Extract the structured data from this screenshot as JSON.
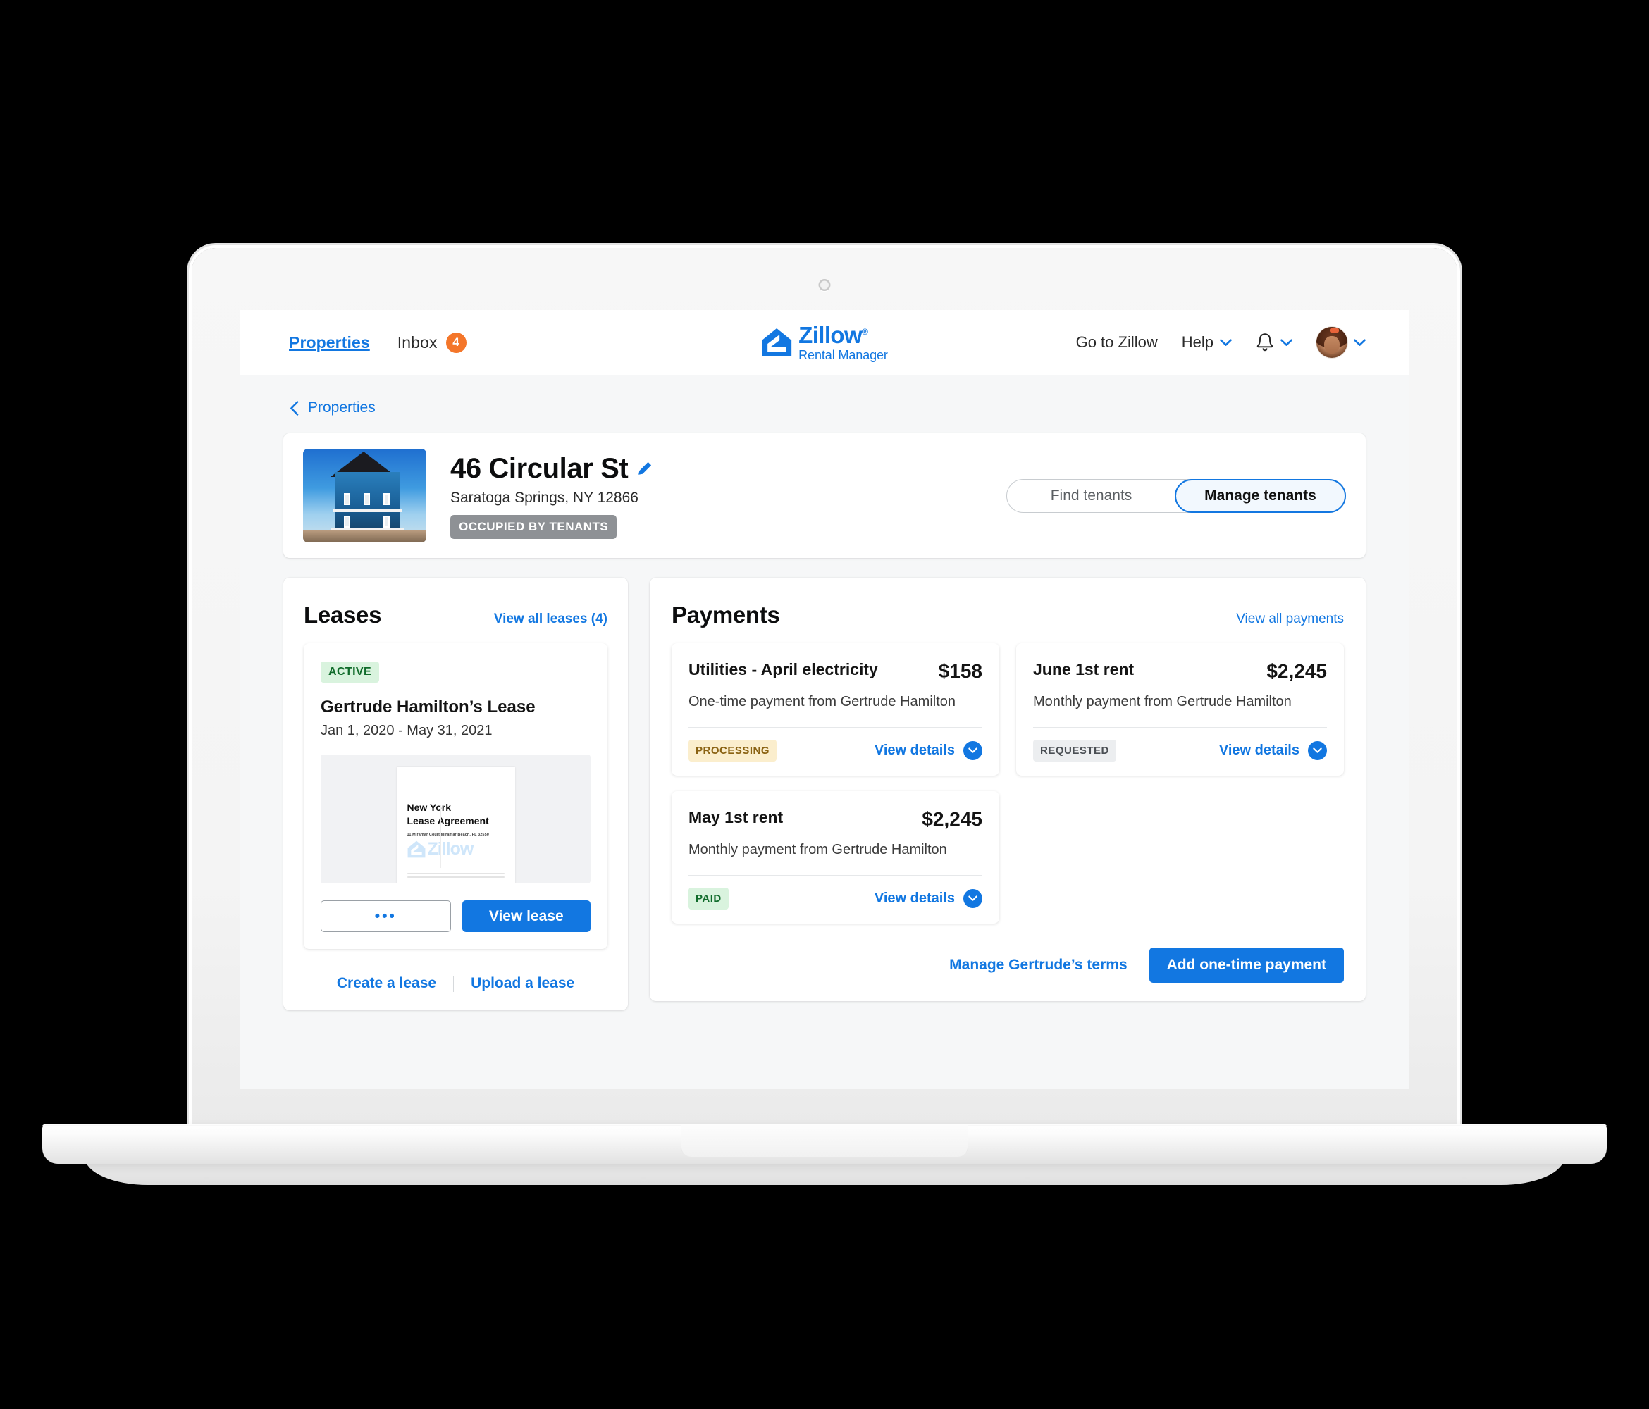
{
  "brand": {
    "name": "Zillow",
    "sub": "Rental Manager",
    "color": "#1277e1"
  },
  "nav": {
    "properties": "Properties",
    "inbox": "Inbox",
    "inbox_count": "4",
    "go_to_zillow": "Go to Zillow",
    "help": "Help"
  },
  "breadcrumb": {
    "label": "Properties"
  },
  "property": {
    "title": "46 Circular St",
    "address": "Saratoga Springs, NY 12866",
    "status": "OCCUPIED BY TENANTS",
    "toggle": {
      "find": "Find tenants",
      "manage": "Manage tenants"
    }
  },
  "leases": {
    "title": "Leases",
    "view_all": "View all leases (4)",
    "card": {
      "status": "ACTIVE",
      "name": "Gertrude Hamilton’s Lease",
      "dates": "Jan 1, 2020 - May 31, 2021",
      "doc": {
        "line1": "New York",
        "line2": "Lease Agreement",
        "address": "11 Miramar Court Miramar Beach, FL 32550",
        "watermark": "Zillow"
      },
      "more_label": "•••",
      "view_label": "View lease"
    },
    "create": "Create a lease",
    "upload": "Upload a lease"
  },
  "payments": {
    "title": "Payments",
    "view_all": "View all payments",
    "details_label": "View details",
    "items": [
      {
        "title": "Utilities - April electricity",
        "amount": "$158",
        "from": "One-time payment from Gertrude Hamilton",
        "status": "PROCESSING",
        "status_kind": "processing"
      },
      {
        "title": "June 1st rent",
        "amount": "$2,245",
        "from": "Monthly payment from Gertrude Hamilton",
        "status": "REQUESTED",
        "status_kind": "requested"
      },
      {
        "title": "May 1st rent",
        "amount": "$2,245",
        "from": "Monthly payment from Gertrude Hamilton",
        "status": "PAID",
        "status_kind": "paid"
      }
    ],
    "manage_terms": "Manage Gertrude’s terms",
    "add_payment": "Add one-time payment"
  }
}
